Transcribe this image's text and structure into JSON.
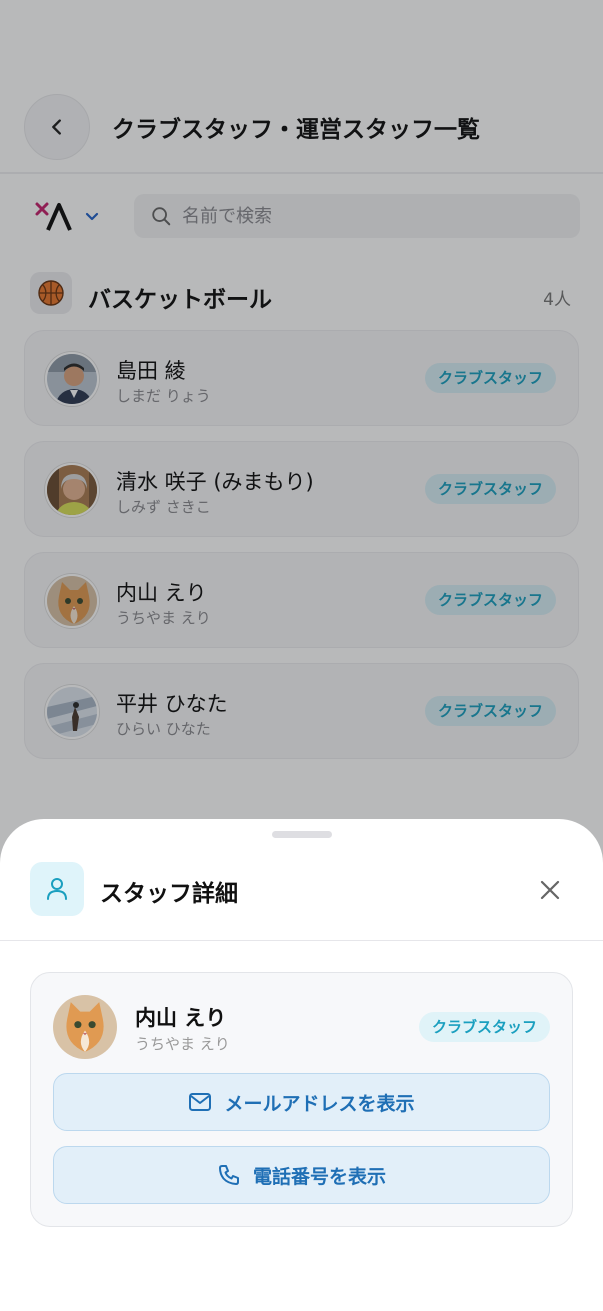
{
  "header": {
    "title": "クラブスタッフ・運営スタッフ一覧"
  },
  "search": {
    "placeholder": "名前で検索"
  },
  "section": {
    "title": "バスケットボール",
    "count": "4人",
    "icon": "basketball-icon"
  },
  "staff": [
    {
      "name": "島田 綾",
      "kana": "しまだ りょう",
      "role": "クラブスタッフ"
    },
    {
      "name": "清水 咲子 (みまもり)",
      "kana": "しみず さきこ",
      "role": "クラブスタッフ"
    },
    {
      "name": "内山 えり",
      "kana": "うちやま えり",
      "role": "クラブスタッフ"
    },
    {
      "name": "平井 ひなた",
      "kana": "ひらい ひなた",
      "role": "クラブスタッフ"
    }
  ],
  "sheet": {
    "title": "スタッフ詳細",
    "selected": {
      "name": "内山 えり",
      "kana": "うちやま えり",
      "role": "クラブスタッフ"
    },
    "email_button": "メールアドレスを表示",
    "phone_button": "電話番号を表示"
  },
  "colors": {
    "accent": "#1a9fbf",
    "action_text": "#1f6fb5",
    "badge_bg": "#d7eef5"
  }
}
